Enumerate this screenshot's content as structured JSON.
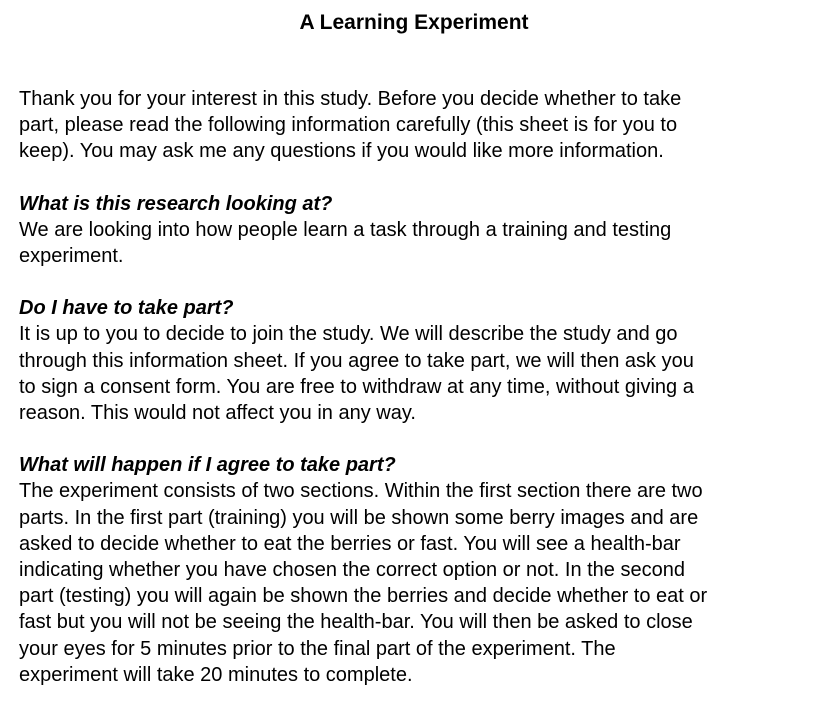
{
  "document": {
    "title": "A Learning Experiment",
    "intro": [
      "Thank you for your interest in this study. Before you decide whether to take",
      "part, please read the following information carefully (this sheet is for you to",
      "keep). You may ask me any questions if you would like more information."
    ],
    "sections": [
      {
        "heading": "What is this research looking at?",
        "lines": [
          "We are looking into how people learn a task through a training and testing",
          "experiment."
        ]
      },
      {
        "heading": "Do I have to take part?",
        "lines": [
          "It is up to you to decide to join the study. We will describe the study and go",
          "through this information sheet. If you agree to take part, we will then ask you",
          "to sign a consent form. You are free to withdraw at any time, without giving a",
          "reason. This would not affect you in any way."
        ]
      },
      {
        "heading": "What will happen if I agree to take part?",
        "lines": [
          "The experiment consists of two sections. Within the first section there are two",
          "parts. In the first part (training) you will be shown some berry images and are",
          "asked to decide whether to eat the berries or fast. You will see a health-bar",
          "indicating whether you have chosen the correct option or not. In the second",
          "part (testing) you will again be shown the berries and decide whether to eat or",
          "fast but you will not be seeing the health-bar. You will then be asked to close",
          "your eyes for 5 minutes prior to the final part of the experiment. The",
          "experiment will take 20 minutes to complete."
        ]
      }
    ]
  }
}
